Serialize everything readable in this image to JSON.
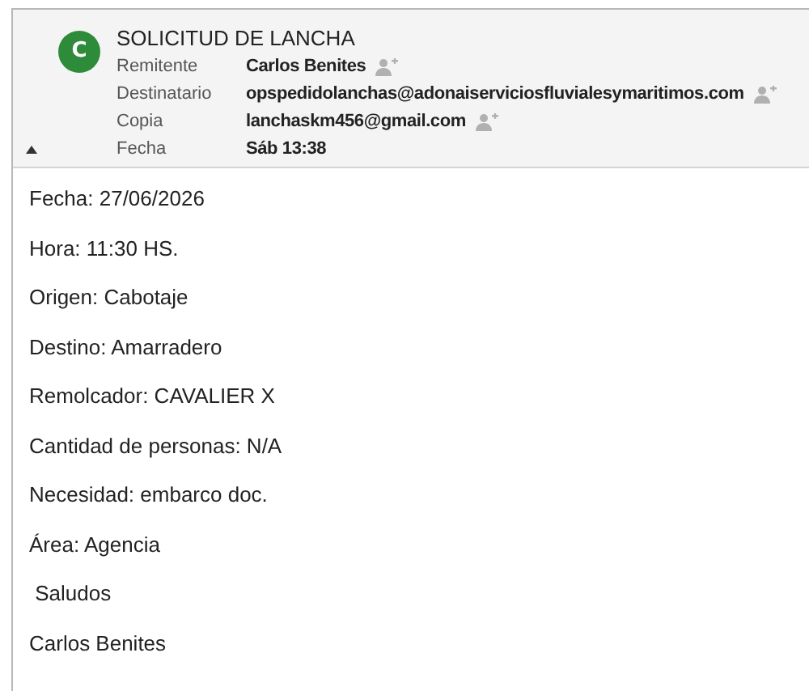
{
  "header": {
    "avatar": {
      "letter": "C",
      "color": "#2e8b3a"
    },
    "subject": "SOLICITUD DE LANCHA",
    "expanded": true,
    "fields": [
      {
        "label": "Remitente",
        "value": "Carlos Benites",
        "add_contact": true
      },
      {
        "label": "Destinatario",
        "value": "opspedidolanchas@adonaiserviciosfluvialesymaritimos.com",
        "add_contact": true
      },
      {
        "label": "Copia",
        "value": "lanchaskm456@gmail.com",
        "add_contact": true
      },
      {
        "label": "Fecha",
        "value": "Sáb 13:38",
        "add_contact": false
      }
    ]
  },
  "body": [
    "Fecha: 27/06/2026",
    "Hora: 11:30 HS.",
    "Origen: Cabotaje",
    "Destino: Amarradero",
    "Remolcador: CAVALIER X",
    "Cantidad de personas: N/A",
    "Necesidad: embarco doc.",
    "Área: Agencia",
    " Saludos",
    "Carlos Benites"
  ]
}
